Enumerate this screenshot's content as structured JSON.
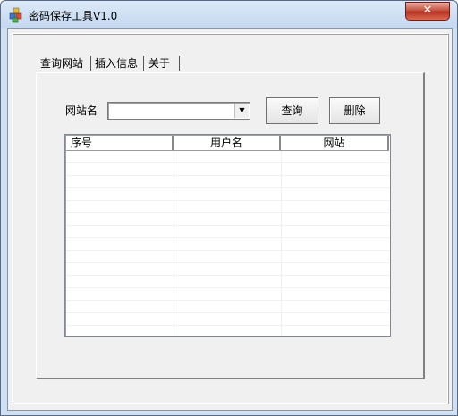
{
  "window": {
    "title": "密码保存工具V1.0",
    "close_glyph": "✕"
  },
  "tabs": [
    {
      "label": "查询网站",
      "active": true
    },
    {
      "label": "插入信息",
      "active": false
    },
    {
      "label": "关于",
      "active": false
    }
  ],
  "query_panel": {
    "site_label": "网站名",
    "site_value": "",
    "dropdown_glyph": "▼",
    "query_button": "查询",
    "delete_button": "删除"
  },
  "table": {
    "columns": [
      "序号",
      "用户名",
      "网站"
    ],
    "rows": []
  },
  "icons": {
    "app": "app-blocks-icon",
    "close": "close-icon",
    "dropdown": "chevron-down-icon"
  },
  "colors": {
    "close_button": "#c75342",
    "titlebar": "#cfe0f4",
    "client": "#f0f0f0"
  }
}
